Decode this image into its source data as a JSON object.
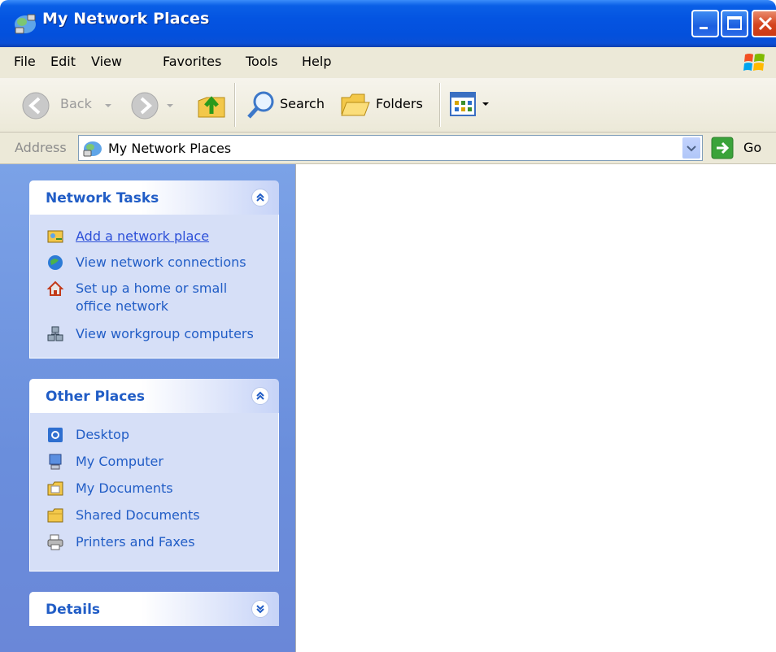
{
  "window": {
    "title": "My Network Places"
  },
  "menubar": {
    "items": [
      "File",
      "Edit",
      "View",
      "Favorites",
      "Tools",
      "Help"
    ]
  },
  "toolbar": {
    "back_label": "Back",
    "search_label": "Search",
    "folders_label": "Folders"
  },
  "addressbar": {
    "label": "Address",
    "value": "My Network Places",
    "go_label": "Go"
  },
  "taskpane": {
    "network_tasks": {
      "title": "Network Tasks",
      "items": [
        {
          "label": "Add a network place",
          "icon": "add-network-place-icon"
        },
        {
          "label": "View network connections",
          "icon": "network-connections-icon"
        },
        {
          "label": "Set up a home or small office network",
          "icon": "home-network-icon"
        },
        {
          "label": "View workgroup computers",
          "icon": "workgroup-icon"
        }
      ]
    },
    "other_places": {
      "title": "Other Places",
      "items": [
        {
          "label": "Desktop",
          "icon": "desktop-icon"
        },
        {
          "label": "My Computer",
          "icon": "my-computer-icon"
        },
        {
          "label": "My Documents",
          "icon": "my-documents-icon"
        },
        {
          "label": "Shared Documents",
          "icon": "folder-icon"
        },
        {
          "label": "Printers and Faxes",
          "icon": "printer-icon"
        }
      ]
    },
    "details": {
      "title": "Details"
    }
  },
  "colors": {
    "titlebar": "#0454e1",
    "taskpane": "#7ba2e7",
    "panel_title": "#215dc6",
    "link": "#2c4fd8"
  }
}
